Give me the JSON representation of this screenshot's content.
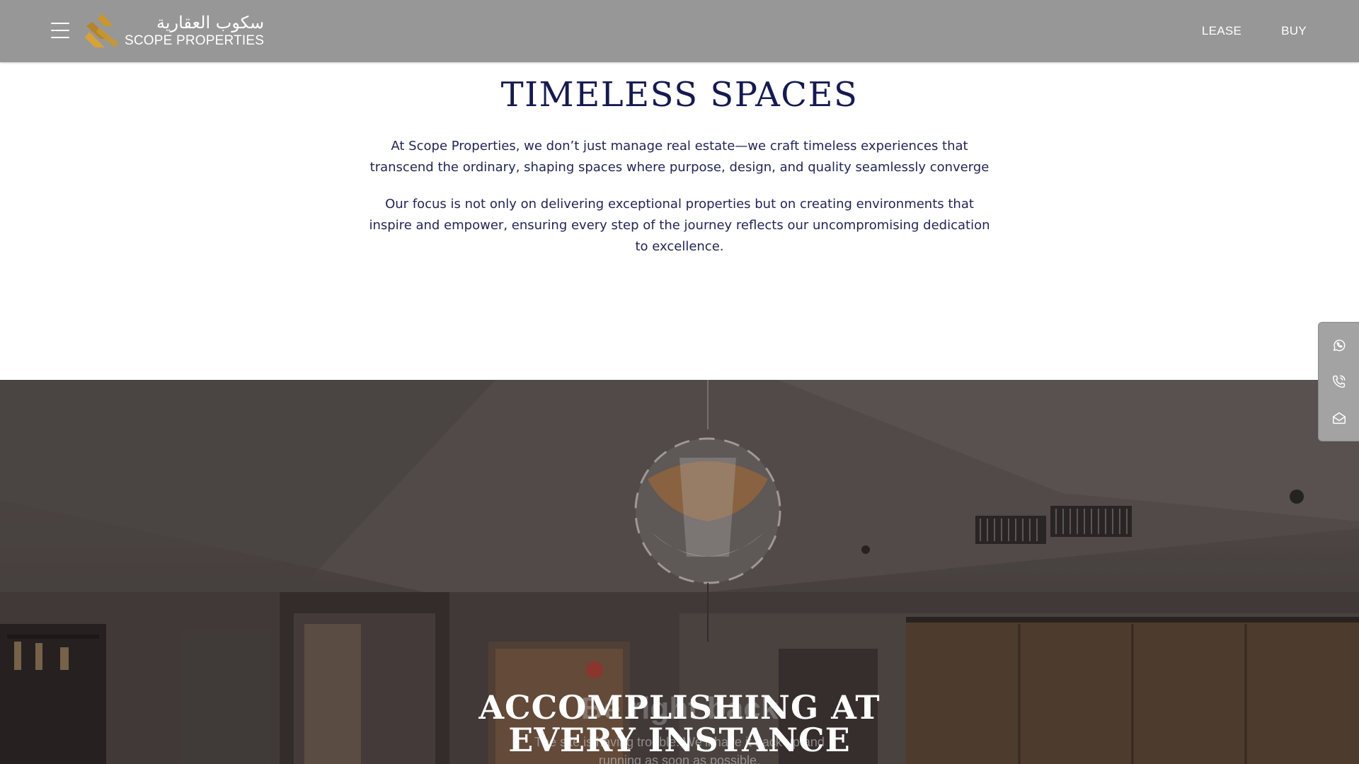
{
  "header": {
    "logo": {
      "arabic_text": "سكوب العقارية",
      "english_text": "SCOPE PROPERTIES",
      "brand_color": "#c9962f"
    },
    "menu_icon": "hamburger-menu-icon",
    "nav": [
      {
        "label": "LEASE"
      },
      {
        "label": "BUY"
      }
    ],
    "background": "#979797"
  },
  "intro": {
    "title": "TIMELESS SPACES",
    "paragraphs": [
      "At Scope Properties, we don’t just manage real estate—we craft timeless experiences that transcend the ordinary, shaping spaces where purpose, design, and quality seamlessly converge",
      "Our focus is not only on delivering exceptional properties but on creating environments that inspire and empower, ensuring every step of the journey reflects our uncompromising dedication to excellence."
    ],
    "text_color": "#151a4f"
  },
  "hero": {
    "title_line1": "ACCOMPLISHING AT",
    "title_line2": "EVERY INSTANCE",
    "ghost_heading": "Be right back",
    "ghost_text": "The site is having trouble. We’ll have it back up and running as soon as possible."
  },
  "contact_bar": {
    "items": [
      {
        "icon": "whatsapp-icon"
      },
      {
        "icon": "phone-icon"
      },
      {
        "icon": "email-icon"
      }
    ]
  }
}
